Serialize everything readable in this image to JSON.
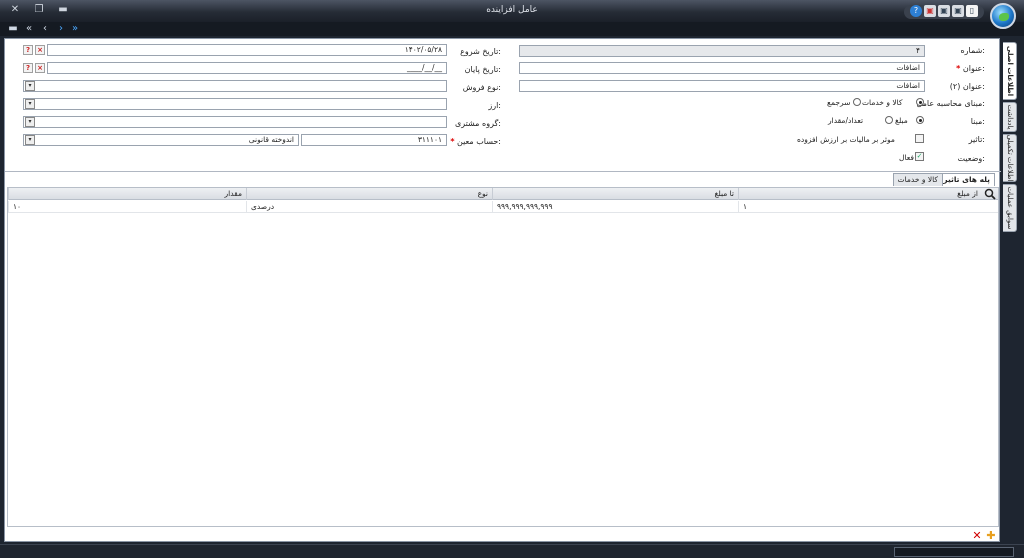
{
  "window": {
    "title": "عامل افزاینده",
    "close_glyph": "✕",
    "restore_glyph": "❐",
    "minimize_glyph": "▬"
  },
  "toolbar": {
    "icons": [
      "help-icon",
      "save-icon",
      "copy-icon",
      "print-icon",
      "new-document-icon"
    ],
    "glyphs": [
      "?",
      "▣",
      "▣",
      "▣",
      "▯"
    ]
  },
  "nav": {
    "menu_glyph": "▬",
    "first_glyph": "«",
    "prev_glyph": "‹",
    "next_glyph": "›",
    "last_glyph": "»"
  },
  "form": {
    "number": {
      "label": "شماره:",
      "value": "۴"
    },
    "title": {
      "label": "عنوان:",
      "value": "اضافات"
    },
    "title2": {
      "label": "عنوان (۲):",
      "value": "اضافات"
    },
    "calc_basis": {
      "label": "مبنای محاسبه عامل:",
      "options": [
        "کالا و خدمات",
        "سرجمع"
      ],
      "selected": "کالا و خدمات"
    },
    "basis": {
      "label": "مبنا:",
      "options": [
        "مبلغ",
        "تعداد/مقدار"
      ],
      "selected": "مبلغ"
    },
    "effect": {
      "label": "تاثیر:",
      "checkbox_label": "موثر بر مالیات بر ارزش افزوده",
      "checked": false
    },
    "status": {
      "label": "وضعیت:",
      "checkbox_label": "فعال",
      "checked": true
    },
    "start_date": {
      "label": "تاریخ شروع:",
      "value": "۱۴۰۲/۰۵/۲۸"
    },
    "end_date": {
      "label": "تاریخ پایان:",
      "value": "__/__/____"
    },
    "sale_type": {
      "label": "نوع فروش:",
      "value": ""
    },
    "currency": {
      "label": "ارز:",
      "value": ""
    },
    "customer_group": {
      "label": "گروه مشتری:",
      "value": ""
    },
    "account": {
      "label": "حساب معین:",
      "code": "۳۱۱۱۰۱",
      "name": "اندوخته قانونی"
    },
    "required_mark": "*",
    "pick_glyph": "?",
    "clear_glyph": "×",
    "dropdown_glyph": "▾",
    "check_glyph": "✓"
  },
  "tabs": [
    {
      "label": "پله های تاثیر",
      "active": true
    },
    {
      "label": "کالا و خدمات",
      "active": false
    }
  ],
  "grid": {
    "columns": [
      "از مبلغ",
      "تا مبلغ",
      "نوع",
      "مقدار"
    ],
    "rows": [
      {
        "from": "۱",
        "to": "۹۹۹,۹۹۹,۹۹۹,۹۹۹",
        "type": "درصدی",
        "amount": "۱۰"
      }
    ]
  },
  "footer": {
    "delete_glyph": "✕",
    "add_glyph": "✚"
  },
  "side_tabs": [
    {
      "label": "اطلاعات اصلی",
      "active": true
    },
    {
      "label": "یادداشت",
      "active": false
    },
    {
      "label": "اطلاعات تکمیلی",
      "active": false
    },
    {
      "label": "سوابق عملیات",
      "active": false
    }
  ],
  "colors": {
    "accent_red": "#d00000",
    "add_orange": "#e8a020",
    "help_blue": "#2d7fd4"
  }
}
